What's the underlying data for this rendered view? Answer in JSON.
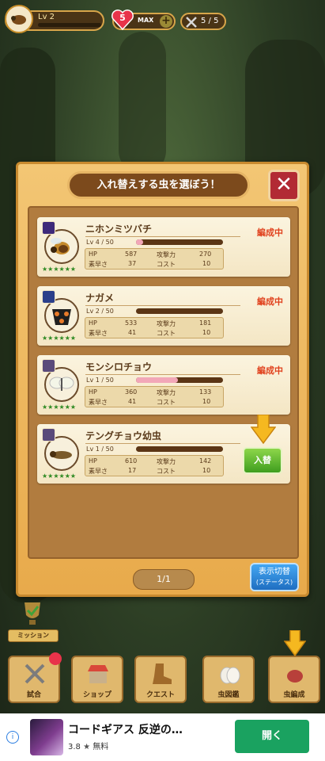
{
  "top": {
    "level": "Lv 2",
    "hearts": "5",
    "max_label": "MAX",
    "battles": "5 / 5"
  },
  "modal": {
    "title": "入れ替えする虫を選ぼう！",
    "close": "✕",
    "page": "1/1",
    "view_toggle": "表示切替",
    "view_toggle_sub": "(ステータス)"
  },
  "labels": {
    "hp": "HP",
    "atk": "攻撃力",
    "spd": "素早さ",
    "cost": "コスト"
  },
  "bugs": [
    {
      "name": "ニホンミツバチ",
      "lv": "Lv 4 / 50",
      "hp": "587",
      "atk": "270",
      "spd": "37",
      "cost": "10",
      "exp": 0.08,
      "status": "編成中",
      "stars": "★★★★★★"
    },
    {
      "name": "ナガメ",
      "lv": "Lv 2 / 50",
      "hp": "533",
      "atk": "181",
      "spd": "41",
      "cost": "10",
      "exp": 0.0,
      "status": "編成中",
      "stars": "★★★★★★"
    },
    {
      "name": "モンシロチョウ",
      "lv": "Lv 1 / 50",
      "hp": "360",
      "atk": "133",
      "spd": "41",
      "cost": "10",
      "exp": 0.48,
      "status": "編成中",
      "stars": "★★★★★★"
    },
    {
      "name": "テングチョウ幼虫",
      "lv": "Lv 1 / 50",
      "hp": "610",
      "atk": "142",
      "spd": "17",
      "cost": "10",
      "exp": 0.0,
      "swap": "入替",
      "stars": "★★★★★★"
    }
  ],
  "menu": {
    "mission": "ミッション",
    "items": [
      "試合",
      "ショップ",
      "クエスト",
      "虫図鑑",
      "虫編成"
    ]
  },
  "ad": {
    "title": "コードギアス 反逆の…",
    "rating": "3.8",
    "price": "無料",
    "button": "開く"
  },
  "colors": {
    "accent": "#e0401c",
    "swap": "#3f9e1f",
    "toggle": "#1f6ec1"
  }
}
